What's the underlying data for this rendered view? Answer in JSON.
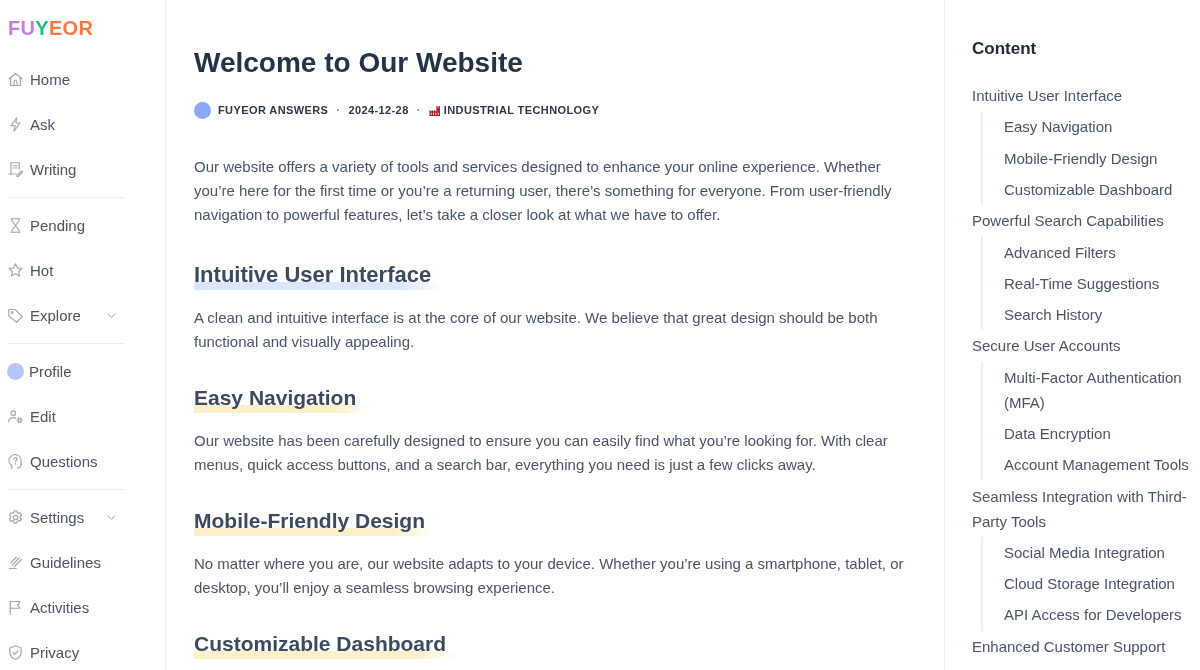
{
  "sidebar": {
    "logo": [
      {
        "text": "FU",
        "color": "#c47fe0"
      },
      {
        "text": "Y",
        "color": "#21bf86"
      },
      {
        "text": "EOR",
        "color": "#f57a45"
      }
    ],
    "groups": [
      {
        "items": [
          {
            "label": "Home",
            "kind": "link"
          },
          {
            "label": "Ask",
            "kind": "link"
          },
          {
            "label": "Writing",
            "kind": "link"
          }
        ]
      },
      {
        "items": [
          {
            "label": "Pending",
            "kind": "link"
          },
          {
            "label": "Hot",
            "kind": "link"
          },
          {
            "label": "Explore",
            "kind": "submenu"
          }
        ]
      },
      {
        "items": [
          {
            "label": "Profile",
            "kind": "avatar"
          },
          {
            "label": "Edit",
            "kind": "link"
          },
          {
            "label": "Questions",
            "kind": "link"
          }
        ]
      },
      {
        "items": [
          {
            "label": "Settings",
            "kind": "submenu"
          },
          {
            "label": "Guidelines",
            "kind": "link"
          },
          {
            "label": "Activities",
            "kind": "link"
          },
          {
            "label": "Privacy",
            "kind": "link"
          }
        ]
      }
    ]
  },
  "article": {
    "title": "Welcome to Our Website",
    "meta": [
      {
        "kind": "author",
        "text": "FUYEOR ANSWERS"
      },
      {
        "kind": "separator",
        "text": "·"
      },
      {
        "kind": "date",
        "text": "2024-12-28"
      },
      {
        "kind": "separator",
        "text": "·"
      },
      {
        "kind": "category",
        "text": "INDUSTRIAL TECHNOLOGY"
      }
    ],
    "intro": "Our website offers a variety of tools and services designed to enhance your online experience. Whether you’re here for the first time or you’re a returning user, there’s something for everyone. From user-friendly navigation to powerful features, let’s take a closer look at what we have to offer.",
    "sections": [
      {
        "kind": "section",
        "heading": "Intuitive User Interface",
        "body": "A clean and intuitive interface is at the core of our website. We believe that great design should be both functional and visually appealing."
      },
      {
        "kind": "subsection",
        "heading": "Easy Navigation",
        "body": "Our website has been carefully designed to ensure you can easily find what you’re looking for. With clear menus, quick access buttons, and a search bar, everything you need is just a few clicks away."
      },
      {
        "kind": "subsection",
        "heading": "Mobile-Friendly Design",
        "body": "No matter where you are, our website adapts to your device. Whether you’re using a smartphone, tablet, or desktop, you’ll enjoy a seamless browsing experience."
      },
      {
        "kind": "subsection",
        "heading": "Customizable Dashboard"
      }
    ]
  },
  "toc": {
    "title": "Content",
    "items": [
      {
        "label": "Intuitive User Interface",
        "children": [
          {
            "label": "Easy Navigation"
          },
          {
            "label": "Mobile-Friendly Design"
          },
          {
            "label": "Customizable Dashboard"
          }
        ]
      },
      {
        "label": "Powerful Search Capabilities",
        "children": [
          {
            "label": "Advanced Filters"
          },
          {
            "label": "Real-Time Suggestions"
          },
          {
            "label": "Search History"
          }
        ]
      },
      {
        "label": "Secure User Accounts",
        "children": [
          {
            "label": "Multi-Factor Authentication (MFA)"
          },
          {
            "label": "Data Encryption"
          },
          {
            "label": "Account Management Tools"
          }
        ]
      },
      {
        "label": "Seamless Integration with Third-Party Tools",
        "children": [
          {
            "label": "Social Media Integration"
          },
          {
            "label": "Cloud Storage Integration"
          },
          {
            "label": "API Access for Developers"
          }
        ]
      },
      {
        "label": "Enhanced Customer Support"
      }
    ]
  }
}
